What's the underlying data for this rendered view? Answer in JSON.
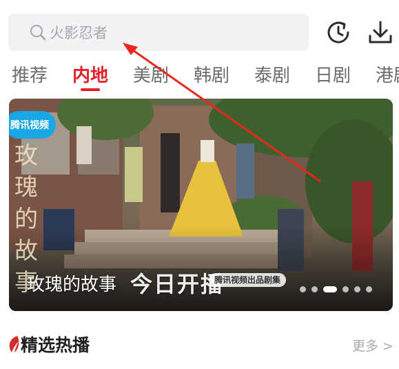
{
  "header": {
    "search_placeholder": "火影忍者",
    "icons": [
      "search-icon",
      "history-icon",
      "download-icon"
    ]
  },
  "tabs": [
    {
      "label": "推荐",
      "active": false
    },
    {
      "label": "内地",
      "active": true
    },
    {
      "label": "美剧",
      "active": false
    },
    {
      "label": "韩剧",
      "active": false
    },
    {
      "label": "泰剧",
      "active": false
    },
    {
      "label": "日剧",
      "active": false
    },
    {
      "label": "港剧",
      "active": false
    }
  ],
  "banner": {
    "title": "玫瑰的故事",
    "vertical_title": "玫瑰的故事",
    "premiere_text": "今日开播",
    "tag": "腾讯视频出品剧集",
    "logo_text": "腾讯视频",
    "carousel": {
      "count": 6,
      "active_index": 2
    }
  },
  "section": {
    "title": "精选热播",
    "more_label": "更多 >"
  },
  "colors": {
    "accent": "#e3222b",
    "tab_inactive": "#6b6d70",
    "search_bg": "#f1f2f4"
  }
}
